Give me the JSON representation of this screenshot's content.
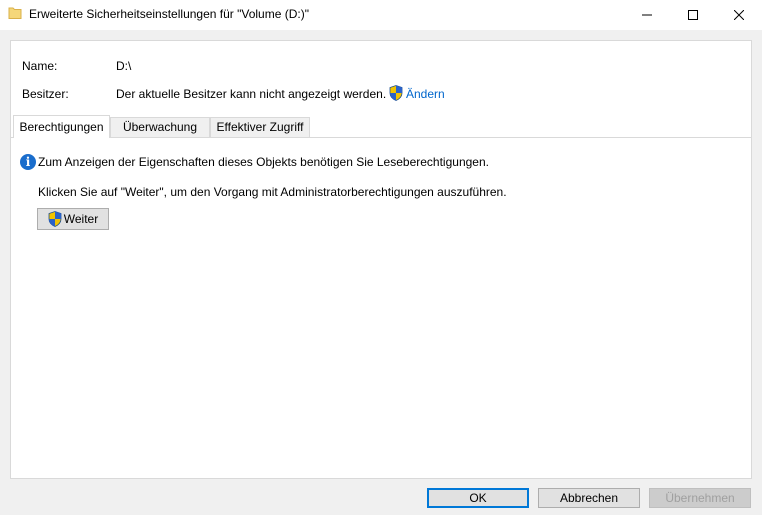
{
  "window": {
    "title": "Erweiterte Sicherheitseinstellungen für \"Volume (D:)\""
  },
  "info": {
    "name_label": "Name:",
    "name_value": "D:\\",
    "owner_label": "Besitzer:",
    "owner_value": "Der aktuelle Besitzer kann nicht angezeigt werden.",
    "change_link": "Ändern"
  },
  "tabs": [
    {
      "label": "Berechtigungen",
      "active": true
    },
    {
      "label": "Überwachung",
      "active": false
    },
    {
      "label": "Effektiver Zugriff",
      "active": false
    }
  ],
  "content": {
    "info_message": "Zum Anzeigen der Eigenschaften dieses Objekts benötigen Sie Leseberechtigungen.",
    "instruction": "Klicken Sie auf \"Weiter\", um den Vorgang mit Administratorberechtigungen auszuführen.",
    "continue_button": "Weiter"
  },
  "buttons": {
    "ok": "OK",
    "cancel": "Abbrechen",
    "apply": "Übernehmen"
  },
  "colors": {
    "link": "#0066cc",
    "info_icon": "#1a6dcc",
    "default_button_border": "#0078d7"
  }
}
